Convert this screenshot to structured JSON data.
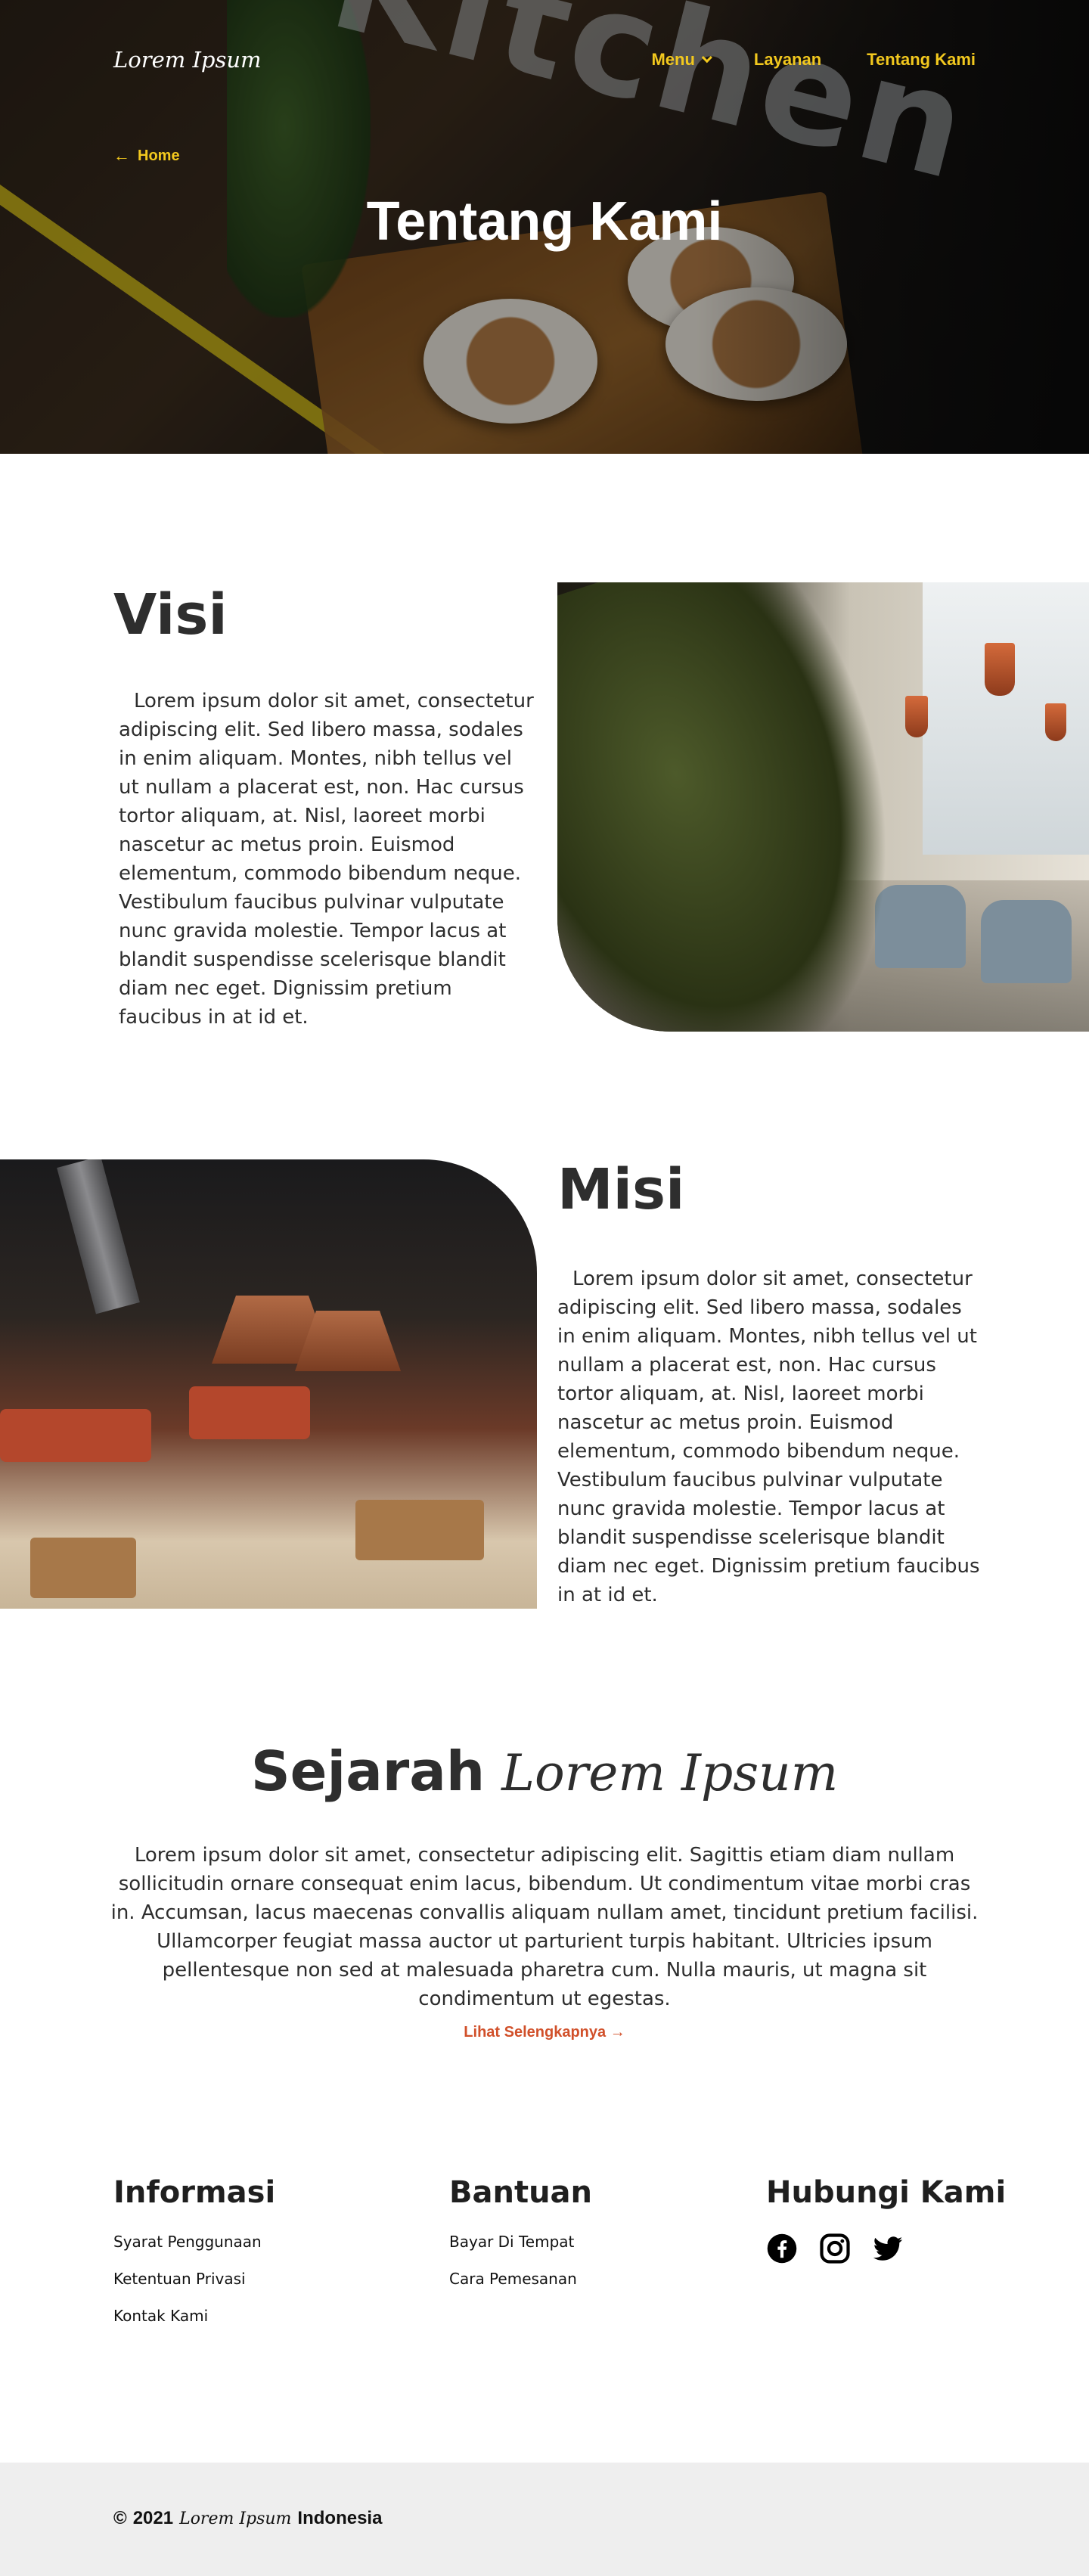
{
  "brand": {
    "logo_text": "Lorem Ipsum"
  },
  "nav": {
    "items": [
      {
        "label": "Menu"
      },
      {
        "label": "Layanan"
      },
      {
        "label": "Tentang Kami"
      }
    ]
  },
  "hero": {
    "breadcrumb": "Home",
    "title": "Tentang Kami",
    "sign_text": "Kitchen"
  },
  "visi": {
    "title": "Visi",
    "text": "Lorem ipsum dolor sit amet, consectetur adipiscing elit. Sed libero massa, sodales in enim aliquam. Montes, nibh tellus vel ut nullam a placerat est, non. Hac cursus tortor aliquam, at. Nisl, laoreet morbi nascetur ac metus proin. Euismod elementum, commodo bibendum neque. Vestibulum faucibus pulvinar vulputate nunc gravida molestie. Tempor lacus at blandit suspendisse scelerisque blandit diam nec eget. Dignissim pretium faucibus in at id et."
  },
  "misi": {
    "title": "Misi",
    "text": "Lorem ipsum dolor sit amet, consectetur adipiscing elit. Sed libero massa, sodales in enim aliquam. Montes, nibh tellus vel ut nullam a placerat est, non. Hac cursus tortor aliquam, at. Nisl, laoreet morbi nascetur ac metus proin. Euismod elementum, commodo bibendum neque. Vestibulum faucibus pulvinar vulputate nunc gravida molestie. Tempor lacus at blandit suspendisse scelerisque blandit diam nec eget. Dignissim pretium faucibus in at id et."
  },
  "sejarah": {
    "title_main": "Sejarah",
    "title_script": "Lorem Ipsum",
    "text": "Lorem ipsum dolor sit amet, consectetur adipiscing elit. Sagittis etiam diam nullam sollicitudin ornare consequat enim lacus, bibendum. Ut condimentum vitae morbi cras in. Accumsan, lacus maecenas convallis aliquam nullam amet, tincidunt pretium facilisi. Ullamcorper feugiat massa auctor ut parturient turpis habitant. Ultricies ipsum pellentesque non sed at malesuada pharetra cum. Nulla mauris, ut magna sit condimentum ut egestas.",
    "more_link": "Lihat Selengkapnya"
  },
  "footer": {
    "informasi": {
      "title": "Informasi",
      "links": [
        "Syarat Penggunaan",
        "Ketentuan Privasi",
        "Kontak Kami"
      ]
    },
    "bantuan": {
      "title": "Bantuan",
      "links": [
        "Bayar Di Tempat",
        "Cara Pemesanan"
      ]
    },
    "hubungi": {
      "title": "Hubungi Kami",
      "socials": [
        "facebook-icon",
        "instagram-icon",
        "twitter-icon"
      ]
    },
    "copyright": {
      "symbol": "©",
      "year": "2021",
      "brand": "Lorem Ipsum",
      "suffix": "Indonesia"
    }
  },
  "colors": {
    "accent_yellow": "#f2c81e",
    "link_orange": "#d1502a",
    "footer_bar": "#eeeeee",
    "text_dark": "#2e2e2e"
  }
}
